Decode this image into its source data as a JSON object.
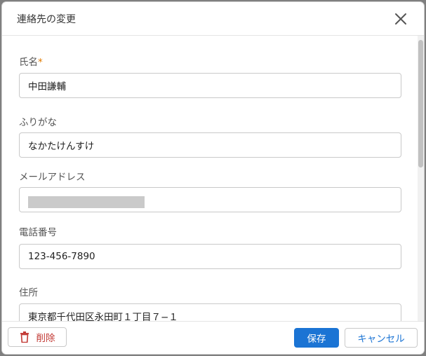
{
  "modal": {
    "title": "連絡先の変更",
    "close_label": "×"
  },
  "form": {
    "name": {
      "label": "氏名",
      "required_mark": "*",
      "value": "中田謙輔"
    },
    "kana": {
      "label": "ふりがな",
      "value": "なかたけんすけ"
    },
    "email": {
      "label": "メールアドレス",
      "value": ""
    },
    "phone": {
      "label": "電話番号",
      "value": "123-456-7890"
    },
    "address": {
      "label": "住所",
      "value": "東京都千代田区永田町１丁目７−１"
    }
  },
  "footer": {
    "delete_label": "削除",
    "save_label": "保存",
    "cancel_label": "キャンセル"
  },
  "colors": {
    "primary": "#1b74d4",
    "danger": "#c23934",
    "required": "#e07a00"
  },
  "icons": {
    "close": "close-icon",
    "delete": "trash-icon"
  }
}
